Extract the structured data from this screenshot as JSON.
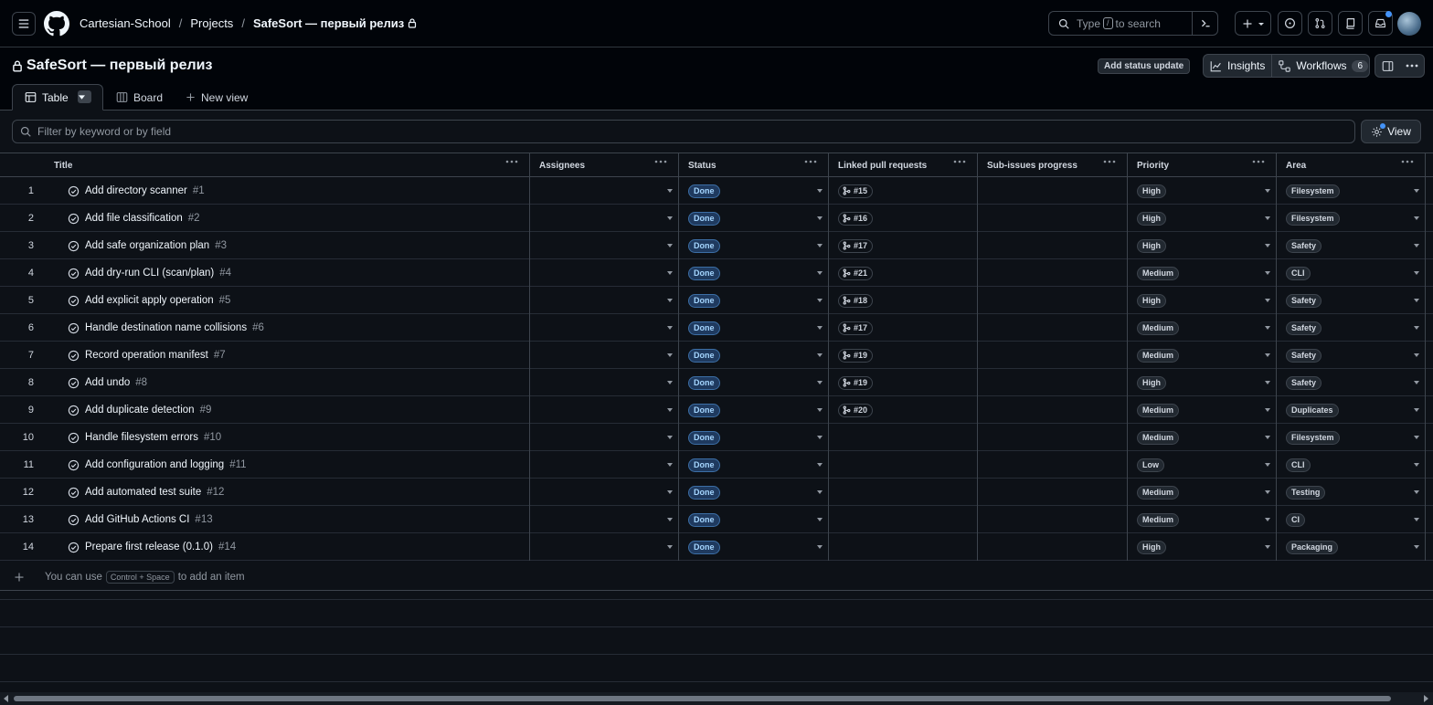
{
  "breadcrumb": {
    "org": "Cartesian-School",
    "projects": "Projects",
    "current": "SafeSort — первый релиз"
  },
  "search": {
    "before": "Type",
    "key": "/",
    "after": "to search"
  },
  "project": {
    "title": "SafeSort — первый релиз",
    "status_update": "Add status update",
    "insights": "Insights",
    "workflows": "Workflows",
    "workflows_count": "6"
  },
  "tabs": {
    "table": "Table",
    "board": "Board",
    "new_view": "New view"
  },
  "filter": {
    "placeholder": "Filter by keyword or by field",
    "view": "View"
  },
  "columns": [
    "Title",
    "Assignees",
    "Status",
    "Linked pull requests",
    "Sub-issues progress",
    "Priority",
    "Area"
  ],
  "rows": [
    {
      "n": "1",
      "title": "Add directory scanner",
      "issue": "#1",
      "status": "Done",
      "pr": "#15",
      "priority": "High",
      "area": "Filesystem"
    },
    {
      "n": "2",
      "title": "Add file classification",
      "issue": "#2",
      "status": "Done",
      "pr": "#16",
      "priority": "High",
      "area": "Filesystem"
    },
    {
      "n": "3",
      "title": "Add safe organization plan",
      "issue": "#3",
      "status": "Done",
      "pr": "#17",
      "priority": "High",
      "area": "Safety"
    },
    {
      "n": "4",
      "title": "Add dry-run CLI (scan/plan)",
      "issue": "#4",
      "status": "Done",
      "pr": "#21",
      "priority": "Medium",
      "area": "CLI"
    },
    {
      "n": "5",
      "title": "Add explicit apply operation",
      "issue": "#5",
      "status": "Done",
      "pr": "#18",
      "priority": "High",
      "area": "Safety"
    },
    {
      "n": "6",
      "title": "Handle destination name collisions",
      "issue": "#6",
      "status": "Done",
      "pr": "#17",
      "priority": "Medium",
      "area": "Safety"
    },
    {
      "n": "7",
      "title": "Record operation manifest",
      "issue": "#7",
      "status": "Done",
      "pr": "#19",
      "priority": "Medium",
      "area": "Safety"
    },
    {
      "n": "8",
      "title": "Add undo",
      "issue": "#8",
      "status": "Done",
      "pr": "#19",
      "priority": "High",
      "area": "Safety"
    },
    {
      "n": "9",
      "title": "Add duplicate detection",
      "issue": "#9",
      "status": "Done",
      "pr": "#20",
      "priority": "Medium",
      "area": "Duplicates"
    },
    {
      "n": "10",
      "title": "Handle filesystem errors",
      "issue": "#10",
      "status": "Done",
      "pr": "",
      "priority": "Medium",
      "area": "Filesystem"
    },
    {
      "n": "11",
      "title": "Add configuration and logging",
      "issue": "#11",
      "status": "Done",
      "pr": "",
      "priority": "Low",
      "area": "CLI"
    },
    {
      "n": "12",
      "title": "Add automated test suite",
      "issue": "#12",
      "status": "Done",
      "pr": "",
      "priority": "Medium",
      "area": "Testing"
    },
    {
      "n": "13",
      "title": "Add GitHub Actions CI",
      "issue": "#13",
      "status": "Done",
      "pr": "",
      "priority": "Medium",
      "area": "CI"
    },
    {
      "n": "14",
      "title": "Prepare first release (0.1.0)",
      "issue": "#14",
      "status": "Done",
      "pr": "",
      "priority": "High",
      "area": "Packaging"
    }
  ],
  "add_item": {
    "before": "You can use",
    "shortcut": "Control + Space",
    "after": "to add an item"
  },
  "colors": {
    "background": "#010409",
    "surface": "#0d1117",
    "border": "#3d444d",
    "accent": "#4493f8",
    "done": "#1f3a5f"
  }
}
